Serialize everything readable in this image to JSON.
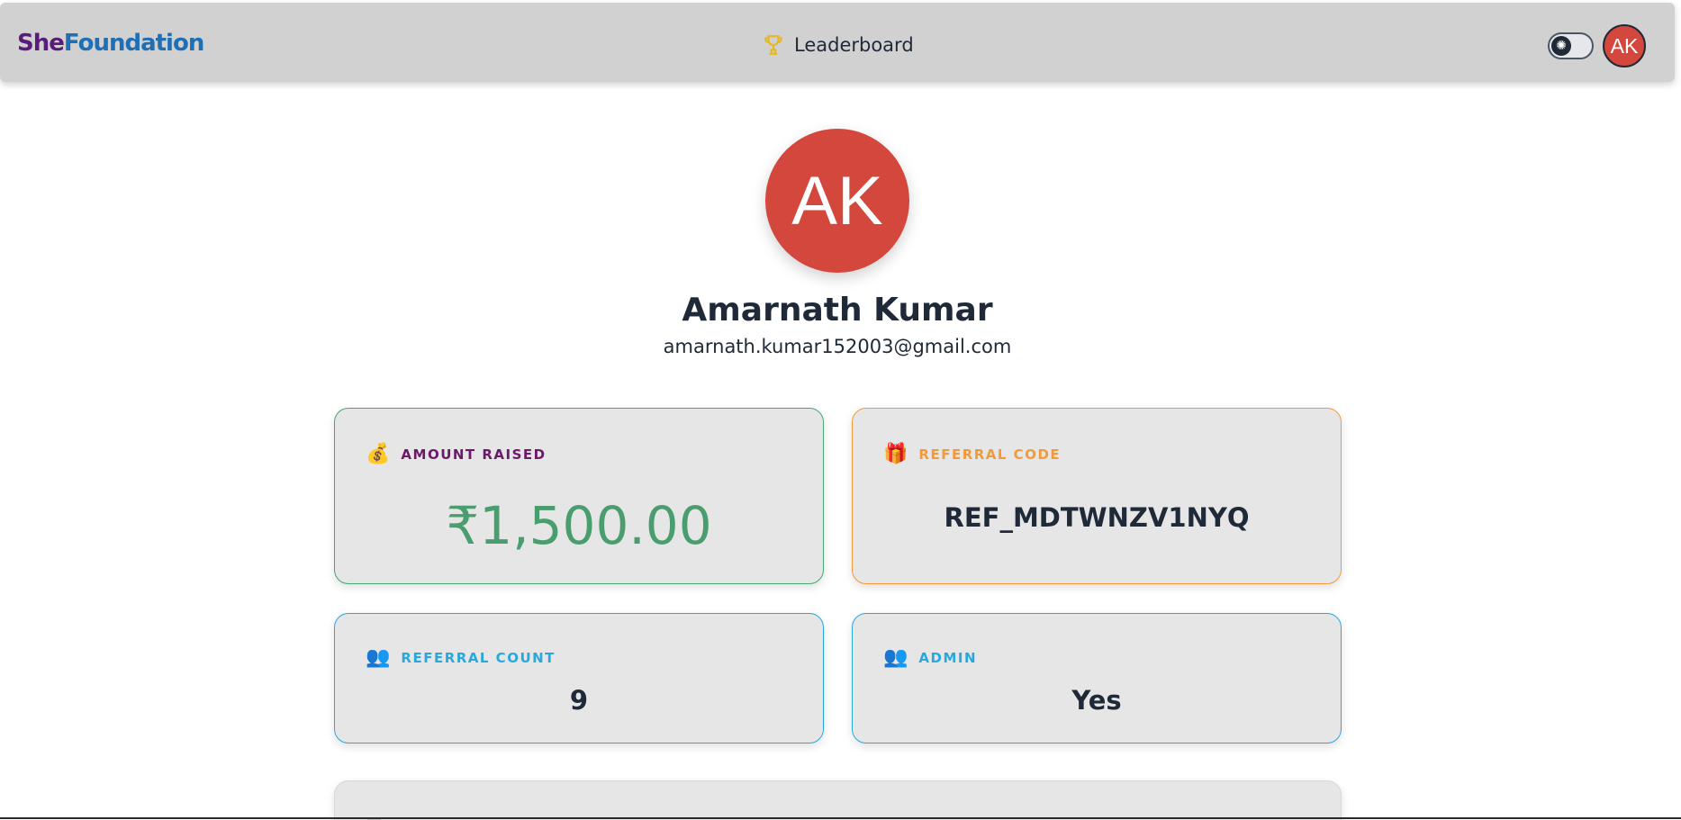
{
  "nav": {
    "brand_she": "She",
    "brand_foundation": "Foundation",
    "leaderboard_label": "Leaderboard",
    "avatar_initials": "AK"
  },
  "profile": {
    "initials": "AK",
    "name": "Amarnath Kumar",
    "email": "amarnath.kumar152003@gmail.com"
  },
  "cards": {
    "amount": {
      "icon": "money-bag-icon",
      "title": "AMOUNT RAISED",
      "value": "₹1,500.00"
    },
    "referral_code": {
      "icon": "gift-icon",
      "title": "REFERRAL CODE",
      "value": "REF_MDTWNZV1NYQ"
    },
    "referral_count": {
      "icon": "people-icon",
      "title": "REFERRAL COUNT",
      "value": "9"
    },
    "admin": {
      "icon": "people-icon",
      "title": "ADMIN",
      "value": "Yes"
    }
  },
  "colors": {
    "navbar_bg": "#d1d1d1",
    "avatar_red": "#d4473d",
    "amount_green": "#48a772",
    "referral_orange": "#f39a38",
    "count_blue": "#29a8e0"
  }
}
